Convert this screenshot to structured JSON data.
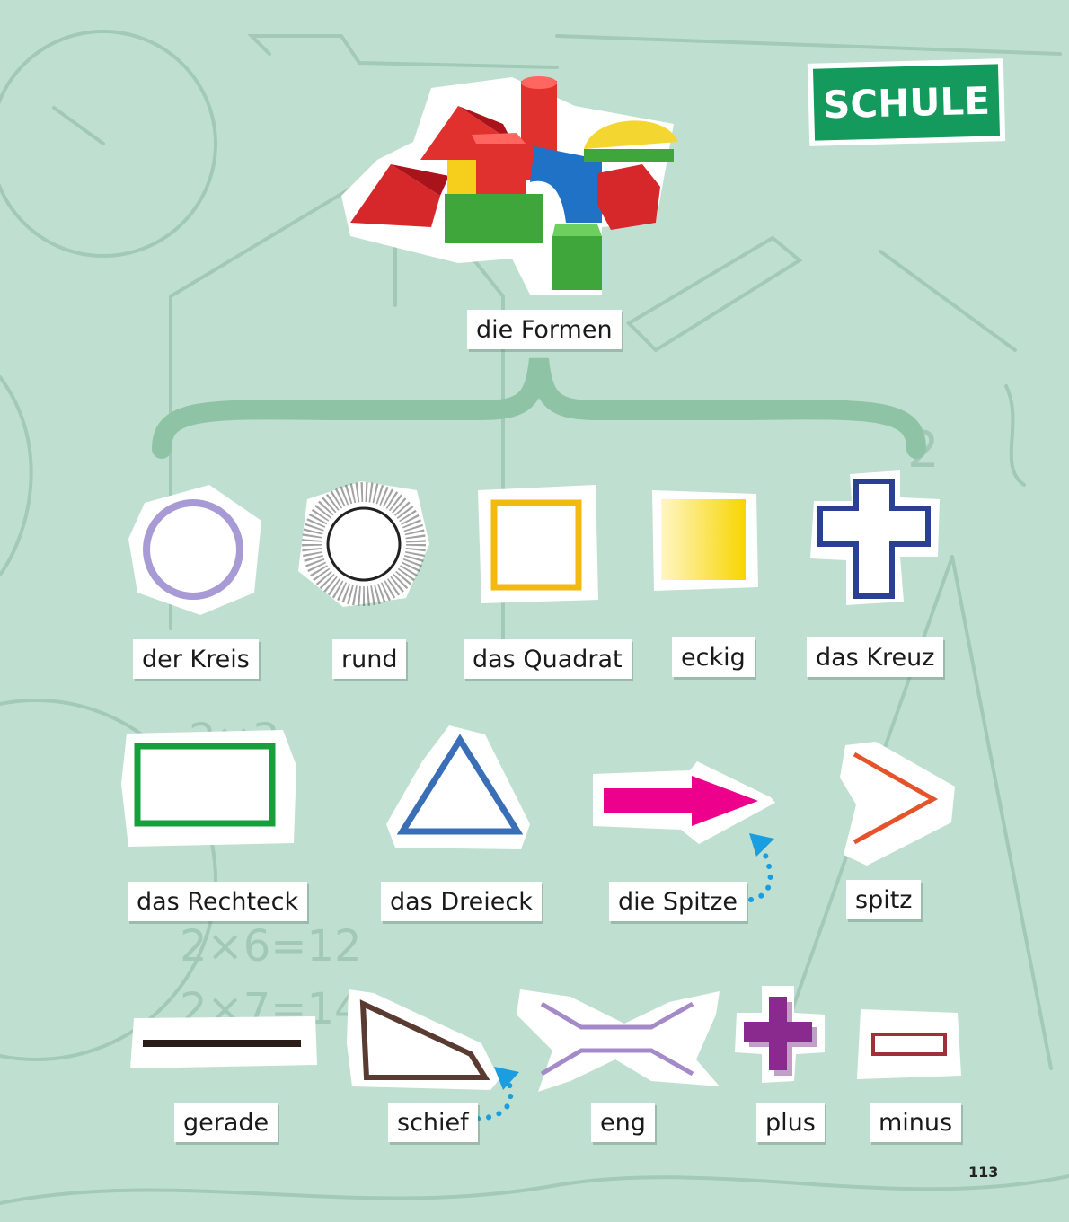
{
  "section_badge": {
    "label": "SCHULE",
    "color": "#139a5c"
  },
  "heading": {
    "label": "die Formen"
  },
  "row1": {
    "circle": "der Kreis",
    "round": "rund",
    "square": "das Quadrat",
    "angular": "eckig",
    "cross": "das Kreuz"
  },
  "row2": {
    "rectangle": "das Rechteck",
    "triangle": "das Dreieck",
    "tip": "die Spitze",
    "pointed": "spitz"
  },
  "row3": {
    "straight": "gerade",
    "slanted": "schief",
    "narrow": "eng",
    "plus": "plus",
    "minus": "minus"
  },
  "page_number": "113",
  "colors": {
    "background": "#bfe0d0",
    "circle": "#a89ad4",
    "square": "#f2b90f",
    "cross": "#2b3f95",
    "rectangle": "#16a03c",
    "triangle": "#3a6fb8",
    "arrow": "#ec008c",
    "chevron": "#e5532a",
    "line": "#2a1d18",
    "slant": "#5a3b32",
    "narrow": "#a48ac8",
    "plus": "#8a2a8f",
    "minus": "#a03038",
    "hint_arrow": "#1a9ee0"
  }
}
